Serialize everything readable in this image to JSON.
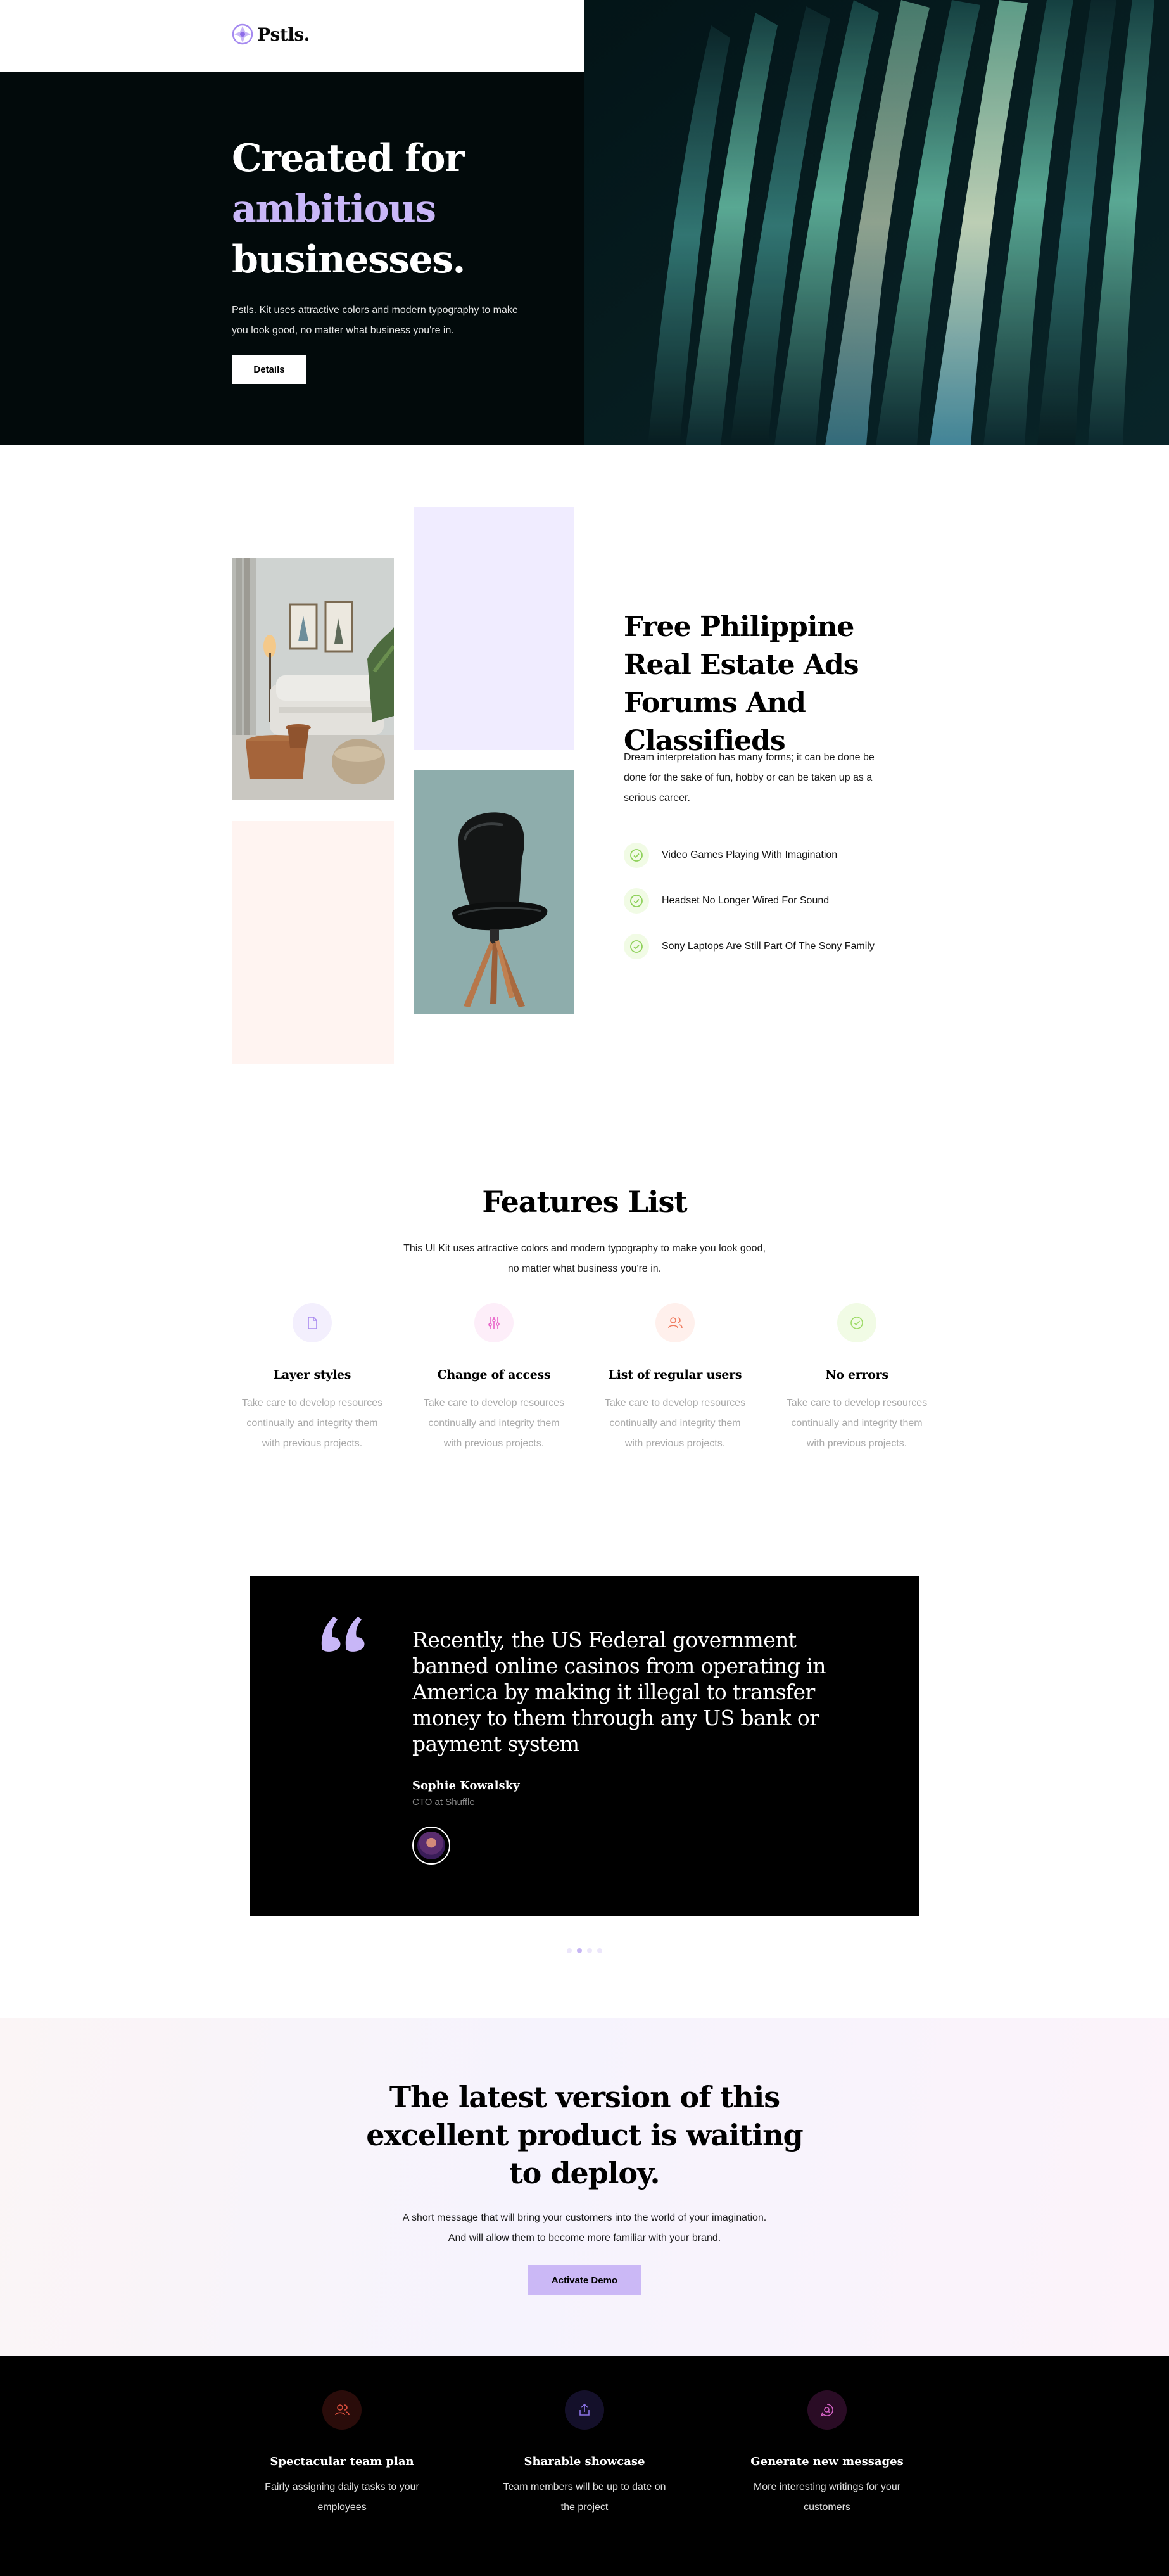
{
  "brand": {
    "name": "Pstls."
  },
  "hero": {
    "title_line1": "Created for",
    "title_line2": "ambitious",
    "title_line3": "businesses.",
    "description": "Pstls. Kit uses attractive colors and modern typography to make you look good, no matter what business you're in.",
    "button_label": "Details"
  },
  "about": {
    "title": "Free Philippine Real Estate Ads Forums And Classifieds",
    "description": "Dream interpretation has many forms; it can be done be done for the sake of fun, hobby or can be taken up as a serious career.",
    "checklist": [
      "Video Games Playing With Imagination",
      "Headset No Longer Wired For Sound",
      "Sony Laptops Are Still Part Of The Sony Family"
    ]
  },
  "features": {
    "title": "Features List",
    "description": "This UI Kit uses attractive colors and modern typography to make you look good, no matter what business you're in.",
    "items": [
      {
        "icon": "file-icon",
        "title": "Layer styles",
        "description": "Take care to develop resources continually and integrity them with previous projects.",
        "color": "#a98af0",
        "bg": "#f3effd"
      },
      {
        "icon": "sliders-icon",
        "title": "Change of access",
        "description": "Take care to develop resources continually and integrity them with previous projects.",
        "color": "#e864c9",
        "bg": "#fdeef9"
      },
      {
        "icon": "users-icon",
        "title": "List of regular users",
        "description": "Take care to develop resources continually and integrity them with previous projects.",
        "color": "#ef7b5f",
        "bg": "#fff0ec"
      },
      {
        "icon": "check-circle-icon",
        "title": "No errors",
        "description": "Take care to develop resources continually and integrity them with previous projects.",
        "color": "#9fdb6a",
        "bg": "#f1fbe5"
      }
    ]
  },
  "testimonial": {
    "quote": "Recently, the US Federal government banned online casinos from operating in America by making it illegal to transfer money to them through any US bank or payment system",
    "author_name": "Sophie Kowalsky",
    "author_role": "CTO at Shuffle",
    "slide_count": 4,
    "active_slide": 2
  },
  "cta": {
    "title": "The latest version of this excellent product is waiting to deploy.",
    "description": "A short message that will bring your customers into the world of your imagination. And will allow them to become more familiar with your brand.",
    "button_label": "Activate Demo"
  },
  "footer_features": [
    {
      "icon": "users-icon",
      "title": "Spectacular team plan",
      "description": "Fairly assigning daily tasks to your employees",
      "color": "#e0513f",
      "bg": "#2a0c0a"
    },
    {
      "icon": "share-icon",
      "title": "Sharable showcase",
      "description": "Team members will be up to date on the project",
      "color": "#8b73e6",
      "bg": "#14102a"
    },
    {
      "icon": "message-search-icon",
      "title": "Generate new messages",
      "description": "More interesting writings for your customers",
      "color": "#d462c4",
      "bg": "#2a0c25"
    }
  ]
}
